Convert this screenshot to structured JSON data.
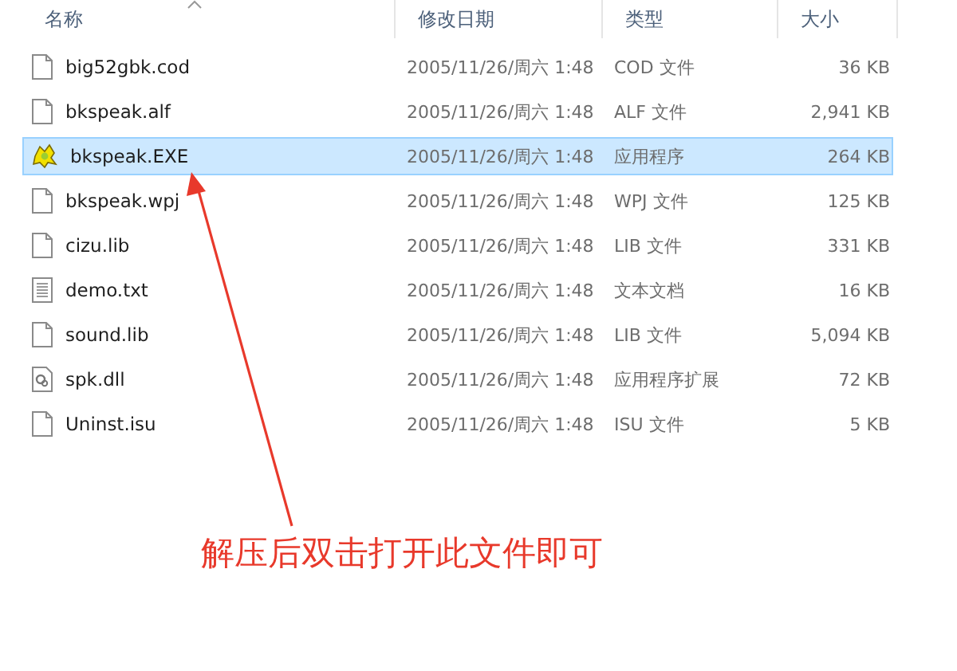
{
  "columns": [
    "名称",
    "修改日期",
    "类型",
    "大小"
  ],
  "files": [
    {
      "name": "big52gbk.cod",
      "date": "2005/11/26/周六 1:48",
      "type": "COD 文件",
      "size": "36 KB",
      "kind": "blank",
      "selected": false
    },
    {
      "name": "bkspeak.alf",
      "date": "2005/11/26/周六 1:48",
      "type": "ALF 文件",
      "size": "2,941 KB",
      "kind": "blank",
      "selected": false
    },
    {
      "name": "bkspeak.EXE",
      "date": "2005/11/26/周六 1:48",
      "type": "应用程序",
      "size": "264 KB",
      "kind": "app",
      "selected": true
    },
    {
      "name": "bkspeak.wpj",
      "date": "2005/11/26/周六 1:48",
      "type": "WPJ 文件",
      "size": "125 KB",
      "kind": "blank",
      "selected": false
    },
    {
      "name": "cizu.lib",
      "date": "2005/11/26/周六 1:48",
      "type": "LIB 文件",
      "size": "331 KB",
      "kind": "blank",
      "selected": false
    },
    {
      "name": "demo.txt",
      "date": "2005/11/26/周六 1:48",
      "type": "文本文档",
      "size": "16 KB",
      "kind": "text",
      "selected": false
    },
    {
      "name": "sound.lib",
      "date": "2005/11/26/周六 1:48",
      "type": "LIB 文件",
      "size": "5,094 KB",
      "kind": "blank",
      "selected": false
    },
    {
      "name": "spk.dll",
      "date": "2005/11/26/周六 1:48",
      "type": "应用程序扩展",
      "size": "72 KB",
      "kind": "library",
      "selected": false
    },
    {
      "name": "Uninst.isu",
      "date": "2005/11/26/周六 1:48",
      "type": "ISU 文件",
      "size": "5 KB",
      "kind": "blank",
      "selected": false
    }
  ],
  "annotation": {
    "text": "解压后双击打开此文件即可"
  }
}
